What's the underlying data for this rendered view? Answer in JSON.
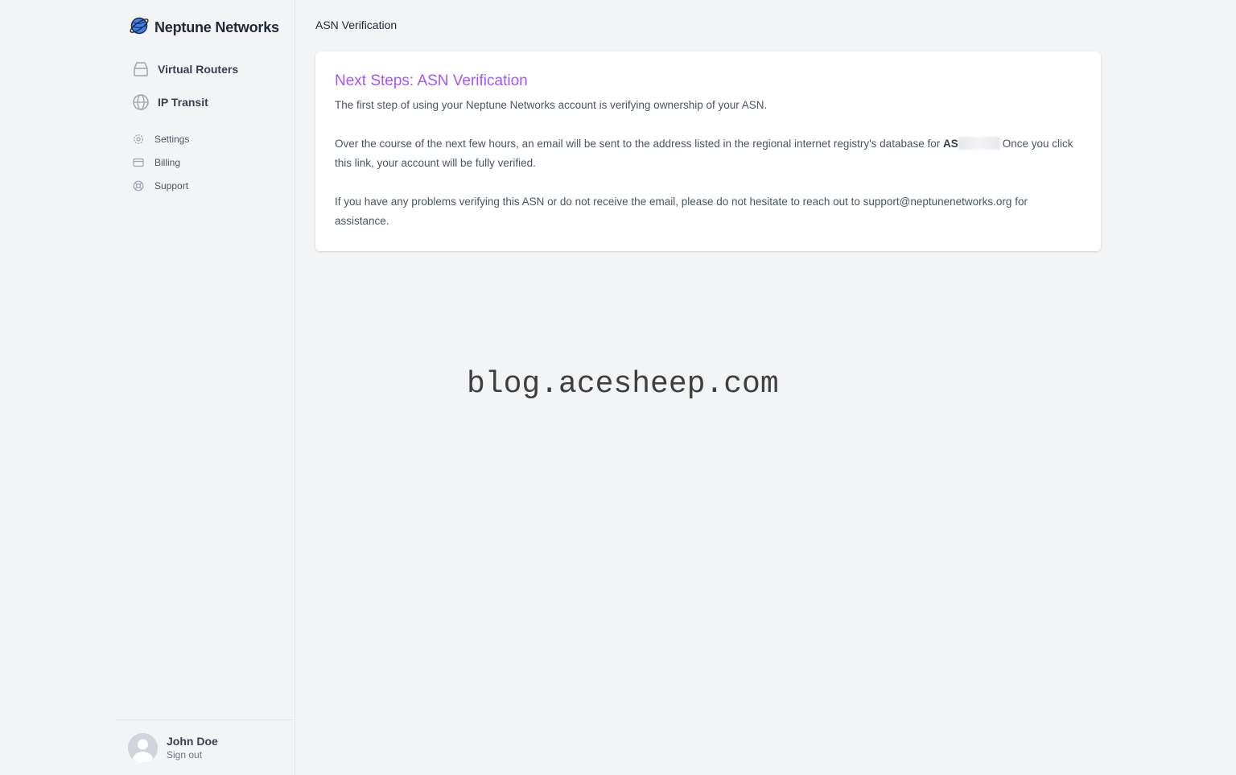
{
  "brand": {
    "name": "Neptune Networks",
    "logo_icon": "planet-icon",
    "accent": "#3b82f6"
  },
  "sidebar": {
    "primary": [
      {
        "label": "Virtual Routers",
        "icon": "router-icon"
      },
      {
        "label": "IP Transit",
        "icon": "globe-icon"
      }
    ],
    "secondary": [
      {
        "label": "Settings",
        "icon": "gear-icon"
      },
      {
        "label": "Billing",
        "icon": "credit-card-icon"
      },
      {
        "label": "Support",
        "icon": "lifebuoy-icon"
      }
    ]
  },
  "user": {
    "name": "John Doe",
    "sign_out": "Sign out"
  },
  "header": {
    "title": "ASN Verification"
  },
  "card": {
    "title": "Next Steps: ASN Verification",
    "title_color": "#a855f7",
    "para1": "The first step of using your Neptune Networks account is verifying ownership of your ASN.",
    "para2_before": "Over the course of the next few hours, an email will be sent to the address listed in the regional internet registry's database for ",
    "asn_prefix": "AS",
    "para2_after": "Once you click this link, your account will be fully verified.",
    "para3_before": "If you have any problems verifying this ASN or do not receive the email, please do not hesitate to reach out to ",
    "support_email": "support@neptunenetworks.org",
    "para3_after": " for assistance."
  },
  "watermark": "blog.acesheep.com"
}
